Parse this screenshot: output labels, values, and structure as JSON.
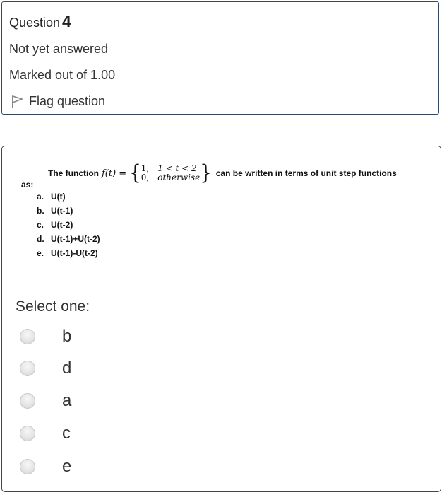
{
  "question_info": {
    "title_prefix": "Question",
    "number": "4",
    "state": "Not yet answered",
    "grade": "Marked out of 1.00",
    "flag_label": "Flag question",
    "flag_icon": "flag-icon"
  },
  "question_text": {
    "intro": "The function",
    "function_lhs": "f(t) =",
    "case1_value": "1,",
    "case1_condition": "1 < t < 2",
    "case2_value": "0,",
    "case2_condition": "otherwise",
    "suffix": "can be written in terms of unit step functions",
    "continuation": "as:",
    "options": [
      {
        "letter": "a.",
        "text": "U(t)"
      },
      {
        "letter": "b.",
        "text": "U(t-1)"
      },
      {
        "letter": "c.",
        "text": "U(t-2)"
      },
      {
        "letter": "d.",
        "text": "U(t-1)+U(t-2)"
      },
      {
        "letter": "e.",
        "text": "U(t-1)-U(t-2)"
      }
    ]
  },
  "answer": {
    "prompt": "Select one:",
    "choices": [
      {
        "label": "b"
      },
      {
        "label": "d"
      },
      {
        "label": "a"
      },
      {
        "label": "c"
      },
      {
        "label": "e"
      }
    ]
  },
  "colors": {
    "border": "#34495e",
    "text": "#333333"
  }
}
